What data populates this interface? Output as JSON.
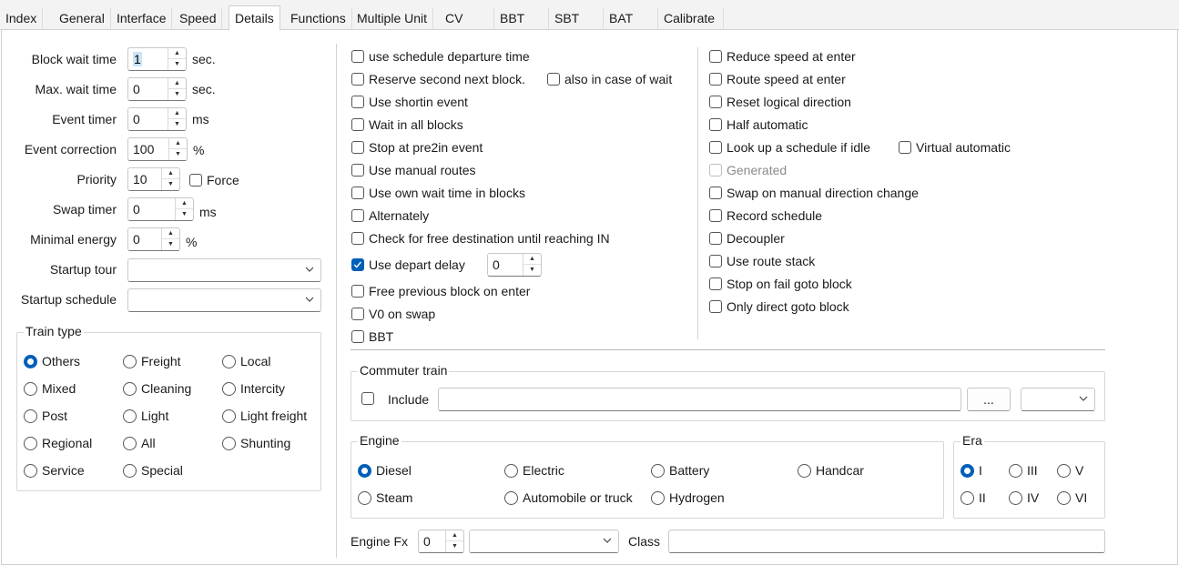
{
  "tabs": [
    "Index",
    "General",
    "Interface",
    "Speed",
    "Details",
    "Functions",
    "Multiple Unit",
    "CV",
    "BBT",
    "SBT",
    "BAT",
    "Calibrate"
  ],
  "left": {
    "block_wait": {
      "label": "Block wait time",
      "value": "1",
      "unit": "sec."
    },
    "max_wait": {
      "label": "Max. wait time",
      "value": "0",
      "unit": "sec."
    },
    "event_timer": {
      "label": "Event timer",
      "value": "0",
      "unit": "ms"
    },
    "event_correction": {
      "label": "Event correction",
      "value": "100",
      "unit": "%"
    },
    "priority": {
      "label": "Priority",
      "value": "10",
      "force_label": "Force"
    },
    "swap_timer": {
      "label": "Swap timer",
      "value": "0",
      "unit": "ms"
    },
    "minimal_energy": {
      "label": "Minimal energy",
      "value": "0",
      "unit": "%"
    },
    "startup_tour": {
      "label": "Startup tour",
      "value": ""
    },
    "startup_schedule": {
      "label": "Startup schedule",
      "value": ""
    }
  },
  "train_type": {
    "title": "Train type",
    "options": [
      "Others",
      "Freight",
      "Local",
      "Mixed",
      "Cleaning",
      "Intercity",
      "Post",
      "Light",
      "Light freight",
      "Regional",
      "All",
      "Shunting",
      "Service",
      "Special"
    ],
    "selected": "Others"
  },
  "mid": {
    "schedule_departure": "use schedule departure time",
    "reserve_second": "Reserve second next block.",
    "also_wait": "also in case of wait",
    "shortin": "Use shortin event",
    "wait_all": "Wait in all blocks",
    "stop_pre2in": "Stop at pre2in event",
    "manual_routes": "Use manual routes",
    "own_wait": "Use own wait time in blocks",
    "alternately": "Alternately",
    "check_free": "Check for free destination until reaching IN",
    "depart_delay": "Use depart delay",
    "depart_delay_value": "0",
    "free_previous": "Free previous block on enter",
    "v0_swap": "V0 on swap",
    "bbt": "BBT"
  },
  "right": {
    "reduce_speed": "Reduce speed at enter",
    "route_speed": "Route speed at enter",
    "reset_logical": "Reset logical direction",
    "half_auto": "Half automatic",
    "lookup_schedule": "Look up a schedule if idle",
    "virtual_auto": "Virtual automatic",
    "generated": "Generated",
    "swap_manual": "Swap on manual direction change",
    "record_schedule": "Record schedule",
    "decoupler": "Decoupler",
    "route_stack": "Use route stack",
    "stop_fail": "Stop on fail goto block",
    "only_direct": "Only direct goto block"
  },
  "commuter": {
    "title": "Commuter train",
    "include": "Include",
    "value": "",
    "browse": "..."
  },
  "engine": {
    "title": "Engine",
    "options": [
      "Diesel",
      "Electric",
      "Battery",
      "Handcar",
      "Steam",
      "Automobile or truck",
      "Hydrogen"
    ],
    "selected": "Diesel"
  },
  "era": {
    "title": "Era",
    "options": [
      "I",
      "III",
      "V",
      "II",
      "IV",
      "VI"
    ],
    "selected": "I"
  },
  "engine_fx": {
    "label": "Engine Fx",
    "value": "0"
  },
  "class": {
    "label": "Class",
    "value": ""
  },
  "colors": {
    "accent": "#005fb8",
    "selection": "#cce4f7"
  }
}
